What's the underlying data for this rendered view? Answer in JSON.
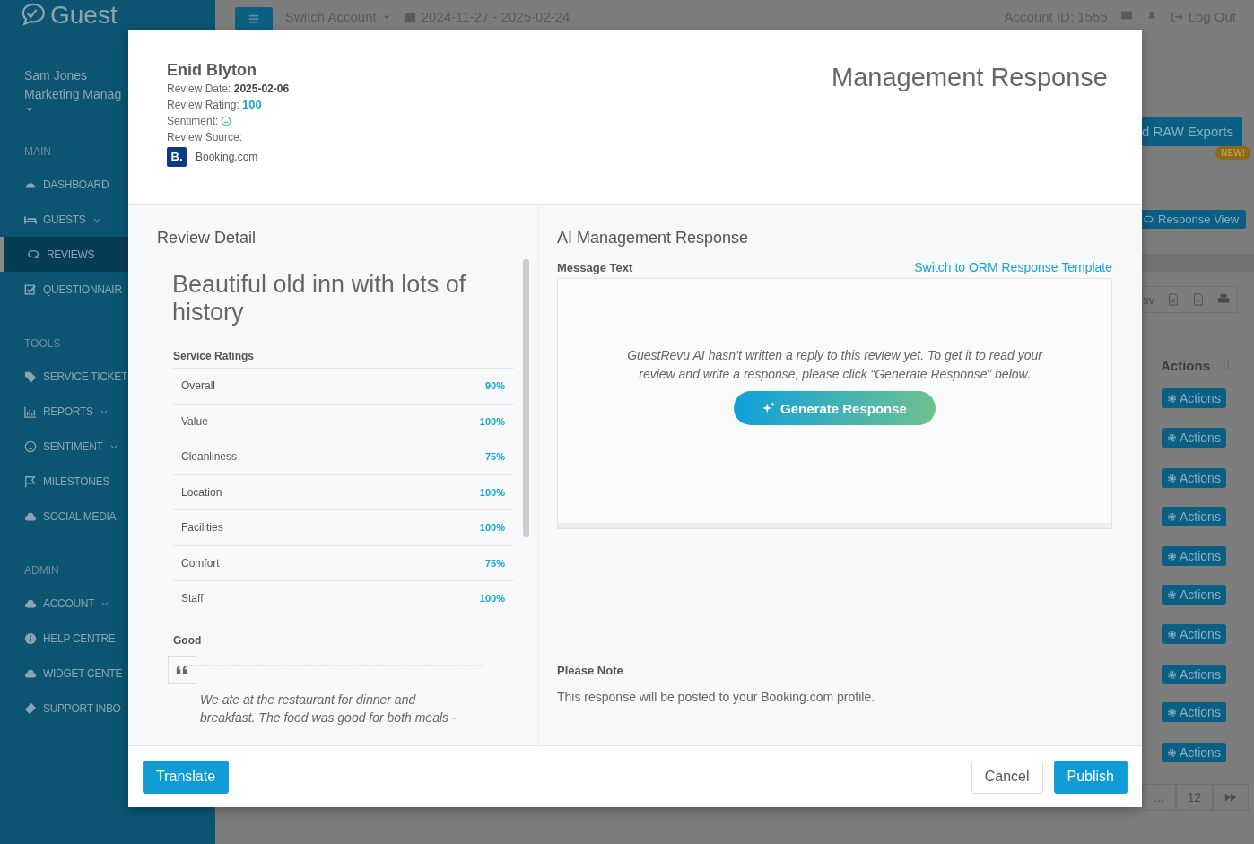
{
  "sidebar": {
    "logo": "Guest",
    "user": {
      "name": "Sam Jones",
      "role": "Marketing Manag"
    },
    "sections": [
      {
        "heading": "MAIN",
        "items": [
          {
            "label": "DASHBOARD",
            "expandable": false,
            "selected": false
          },
          {
            "label": "GUESTS",
            "expandable": true,
            "selected": false
          },
          {
            "label": "REVIEWS",
            "expandable": false,
            "selected": true
          },
          {
            "label": "QUESTIONNAIR",
            "expandable": false,
            "selected": false
          }
        ]
      },
      {
        "heading": "TOOLS",
        "items": [
          {
            "label": "SERVICE TICKET",
            "expandable": false,
            "selected": false
          },
          {
            "label": "REPORTS",
            "expandable": true,
            "selected": false
          },
          {
            "label": "SENTIMENT",
            "expandable": true,
            "selected": false
          },
          {
            "label": "MILESTONES",
            "expandable": false,
            "selected": false
          },
          {
            "label": "SOCIAL MEDIA",
            "expandable": false,
            "selected": false
          }
        ]
      },
      {
        "heading": "ADMIN",
        "items": [
          {
            "label": "ACCOUNT",
            "expandable": true,
            "selected": false
          },
          {
            "label": "HELP CENTRE",
            "expandable": false,
            "selected": false
          },
          {
            "label": "WIDGET CENTE",
            "expandable": false,
            "selected": false
          },
          {
            "label": "SUPPORT INBO",
            "expandable": false,
            "selected": false
          }
        ]
      }
    ]
  },
  "topbar": {
    "switch_account": "Switch Account",
    "date_range": "2024-11-27 - 2025-02-24",
    "account_id": "Account ID: 1555",
    "logout": "Log Out"
  },
  "background": {
    "raw_exports": "d RAW Exports",
    "new_badge": "NEW!",
    "response_view": "Response View",
    "export_label": "sv",
    "actions_header": "Actions",
    "row_actions": [
      "Actions",
      "Actions",
      "Actions",
      "Actions",
      "Actions",
      "Actions",
      "Actions",
      "Actions",
      "Actions",
      "Actions"
    ],
    "pagination": [
      "...",
      "12"
    ]
  },
  "modal": {
    "reviewer": "Enid Blyton",
    "review_date_label": "Review Date:",
    "review_date": "2025-02-06",
    "rating_label": "Review Rating:",
    "rating": "100",
    "sentiment_label": "Sentiment:",
    "source_label": "Review Source:",
    "source_logo": "B.",
    "source": "Booking.com",
    "title": "Management Response",
    "review_detail": {
      "heading": "Review Detail",
      "review_title": "Beautiful old inn with lots of history",
      "ratings_heading": "Service Ratings",
      "ratings": [
        {
          "label": "Overall",
          "value": "90%"
        },
        {
          "label": "Value",
          "value": "100%"
        },
        {
          "label": "Cleanliness",
          "value": "75%"
        },
        {
          "label": "Location",
          "value": "100%"
        },
        {
          "label": "Facilities",
          "value": "100%"
        },
        {
          "label": "Comfort",
          "value": "75%"
        },
        {
          "label": "Staff",
          "value": "100%"
        }
      ],
      "good_heading": "Good",
      "good_text": "We ate at the restaurant for dinner and breakfast. The food was good for both meals -"
    },
    "ai": {
      "heading": "AI Management Response",
      "message_label": "Message Text",
      "switch_link": "Switch to ORM Response Template",
      "empty_message": "GuestRevu AI hasn’t written a reply to this review yet. To get it to read your review and write a response, please click “Generate Response” below.",
      "generate": "Generate Response",
      "note_heading": "Please Note",
      "note": "This response will be posted to your Booking.com profile."
    },
    "footer": {
      "translate": "Translate",
      "cancel": "Cancel",
      "publish": "Publish"
    }
  }
}
